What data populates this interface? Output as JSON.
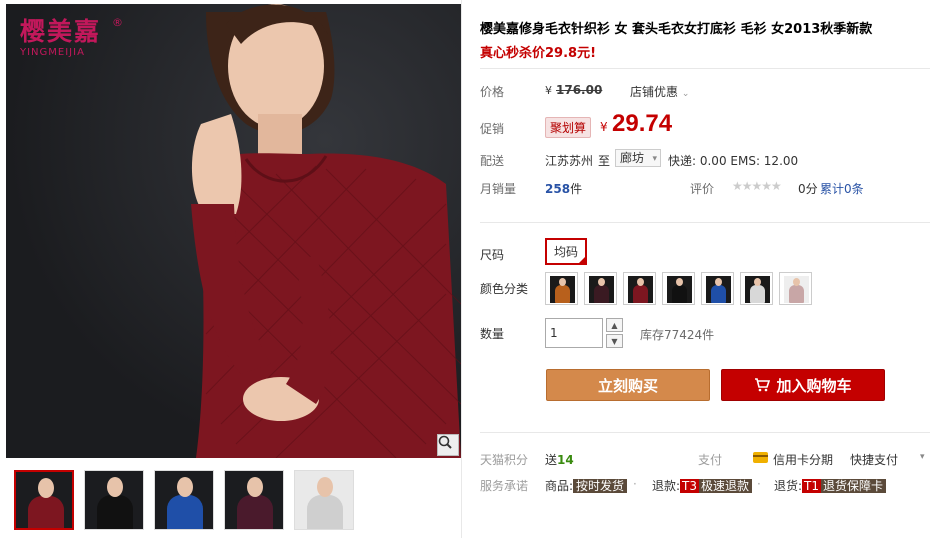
{
  "brand": {
    "name_cn": "樱美嘉",
    "reg_mark": "®",
    "name_en": "YINGMEIJIA"
  },
  "gallery": {
    "thumbnails": [
      {
        "color": "#7d1620",
        "active": true
      },
      {
        "color": "#111111",
        "active": false
      },
      {
        "color": "#1f4fa8",
        "active": false
      },
      {
        "color": "#4a1a2c",
        "active": false
      },
      {
        "color": "#cfcfcf",
        "active": false
      }
    ]
  },
  "product": {
    "title": "樱美嘉修身毛衣针织衫 女 套头毛衣女打底衫 毛衫 女2013秋季新款",
    "slogan": "真心秒杀价29.8元!"
  },
  "price": {
    "label": "价格",
    "currency": "¥",
    "original": "176.00",
    "shop_promo": "店铺优惠",
    "chevron": "⌄"
  },
  "promo": {
    "label": "促销",
    "tag": "聚划算",
    "currency": "¥",
    "value": "29.74"
  },
  "shipping": {
    "label": "配送",
    "from": "江苏苏州",
    "to_label": "至",
    "to": "廊坊",
    "caret": "▾",
    "fee": "快递: 0.00 EMS: 12.00"
  },
  "sales": {
    "label": "月销量",
    "count": "258",
    "unit": "件",
    "rating_label": "评价",
    "stars": "★★★★★",
    "score": "0分",
    "reviews": "累计0条"
  },
  "size": {
    "label": "尺码",
    "option": "均码"
  },
  "color": {
    "label": "颜色分类",
    "options": [
      "#b8601c",
      "#3a1a22",
      "#7d1620",
      "#111111",
      "#1f4fa8",
      "#d8d8d8",
      "#c8a6a6"
    ]
  },
  "quantity": {
    "label": "数量",
    "value": "1",
    "up": "▲",
    "down": "▼",
    "stock": "库存77424件"
  },
  "actions": {
    "buy": "立刻购买",
    "cart": "加入购物车"
  },
  "tmall": {
    "points_label": "天猫积分",
    "points_prefix": "送",
    "points_value": "14",
    "pay_label": "支付",
    "credit": "信用卡分期",
    "quick_pay": "快捷支付",
    "caret": "▾"
  },
  "service": {
    "label": "服务承诺",
    "goods_label": "商品:",
    "goods_badge": "按时发货",
    "refund_label": "退款:",
    "refund_prefix": "T3",
    "refund_badge": "极速退款",
    "return_label": "退货:",
    "return_prefix": "T1",
    "return_badge": "退货保障卡",
    "sep": "·"
  }
}
